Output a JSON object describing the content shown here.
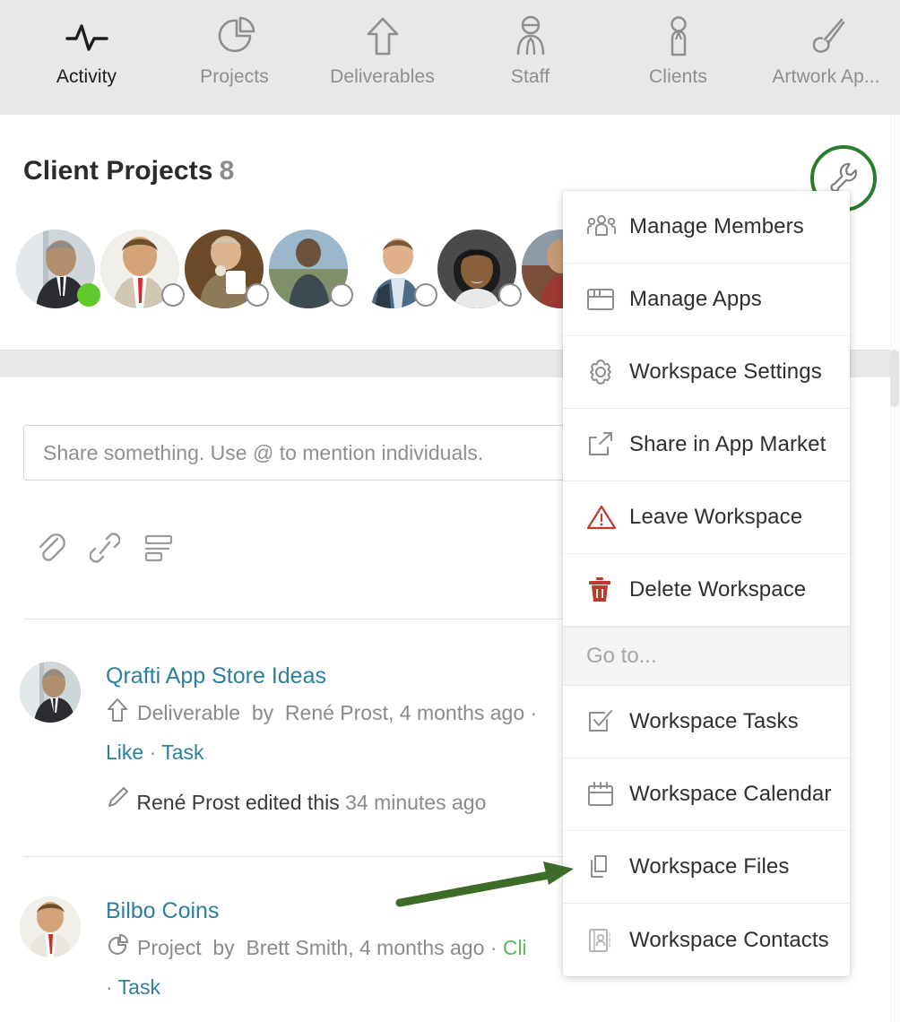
{
  "nav": {
    "items": [
      {
        "label": "Activity",
        "icon": "pulse-icon",
        "active": true
      },
      {
        "label": "Projects",
        "icon": "pie-chart-icon",
        "active": false
      },
      {
        "label": "Deliverables",
        "icon": "up-arrow-icon",
        "active": false
      },
      {
        "label": "Staff",
        "icon": "person-staff-icon",
        "active": false
      },
      {
        "label": "Clients",
        "icon": "person-client-icon",
        "active": false
      },
      {
        "label": "Artwork Ap...",
        "icon": "paintbrush-icon",
        "active": false
      }
    ]
  },
  "header": {
    "title": "Client Projects",
    "count": "8",
    "settings_button": "wrench-icon",
    "members": [
      {
        "name": "member-1",
        "status": "online"
      },
      {
        "name": "member-2",
        "status": "offline"
      },
      {
        "name": "member-3",
        "status": "offline"
      },
      {
        "name": "member-4",
        "status": "offline"
      },
      {
        "name": "member-5",
        "status": "offline"
      },
      {
        "name": "member-6",
        "status": "offline"
      },
      {
        "name": "member-7",
        "status": "offline"
      }
    ]
  },
  "composer": {
    "placeholder": "Share something. Use @ to mention individuals.",
    "value": "",
    "tools": [
      {
        "name": "attachment-icon"
      },
      {
        "name": "link-icon"
      },
      {
        "name": "text-format-icon"
      }
    ]
  },
  "feed": {
    "items": [
      {
        "title": "Qrafti App Store Ideas",
        "type_icon": "up-arrow-icon",
        "type": "Deliverable",
        "by_word": "by",
        "author": "René Prost,",
        "time": "4 months ago",
        "sep": "·",
        "actions": [
          "Like",
          "Task"
        ],
        "action_sep": "·",
        "edit_note": {
          "icon": "pencil-icon",
          "name": "René Prost",
          "verb": "edited this",
          "time": "34 minutes ago"
        }
      },
      {
        "title": "Bilbo Coins",
        "type_icon": "pie-chart-icon",
        "type": "Project",
        "by_word": "by",
        "author": "Brett Smith,",
        "time": "4 months ago",
        "sep": "·",
        "workspace": "Cli",
        "actions": [
          "Task"
        ],
        "action_sep": "·"
      }
    ]
  },
  "dropdown": {
    "items": [
      {
        "label": "Manage Members",
        "icon": "people-group-icon",
        "variant": "normal"
      },
      {
        "label": "Manage Apps",
        "icon": "browser-window-icon",
        "variant": "normal"
      },
      {
        "label": "Workspace Settings",
        "icon": "gear-icon",
        "variant": "normal"
      },
      {
        "label": "Share in App Market",
        "icon": "share-export-icon",
        "variant": "normal"
      },
      {
        "label": "Leave Workspace",
        "icon": "warning-triangle-icon",
        "variant": "danger"
      },
      {
        "label": "Delete Workspace",
        "icon": "trash-icon",
        "variant": "danger"
      }
    ],
    "section_header": "Go to...",
    "goto_items": [
      {
        "label": "Workspace Tasks",
        "icon": "checkbox-task-icon"
      },
      {
        "label": "Workspace Calendar",
        "icon": "calendar-icon"
      },
      {
        "label": "Workspace Files",
        "icon": "files-copy-icon"
      },
      {
        "label": "Workspace Contacts",
        "icon": "contact-book-icon"
      }
    ]
  },
  "annotations": {
    "highlight_circle_color": "#277d2b",
    "arrow_color": "#3d6b28",
    "arrow_target": "Workspace Files"
  },
  "colors": {
    "nav_bg": "#e8e8e8",
    "link": "#2c7ea1",
    "online": "#5fc92b",
    "danger": "#c0392b",
    "muted": "#8a8a8a"
  }
}
